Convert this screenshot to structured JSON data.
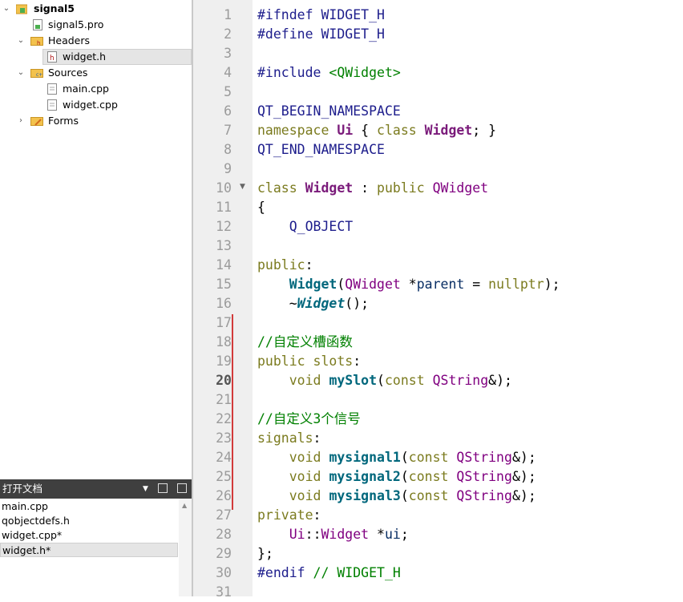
{
  "project_tree": {
    "items": [
      {
        "label": "signal5",
        "icon": "qt-project-icon",
        "level": 0,
        "expanded": true,
        "bold": true
      },
      {
        "label": "signal5.pro",
        "icon": "pro-file-icon",
        "level": 1
      },
      {
        "label": "Headers",
        "icon": "folder-headers-icon",
        "level": 1,
        "expanded": true
      },
      {
        "label": "widget.h",
        "icon": "header-file-icon",
        "level": 2,
        "selected": true
      },
      {
        "label": "Sources",
        "icon": "folder-sources-icon",
        "level": 1,
        "expanded": true
      },
      {
        "label": "main.cpp",
        "icon": "cpp-file-icon",
        "level": 2
      },
      {
        "label": "widget.cpp",
        "icon": "cpp-file-icon",
        "level": 2
      },
      {
        "label": "Forms",
        "icon": "folder-forms-icon",
        "level": 1,
        "expanded": false
      }
    ]
  },
  "open_documents": {
    "title": "打开文档",
    "items": [
      {
        "label": "main.cpp"
      },
      {
        "label": "qobjectdefs.h"
      },
      {
        "label": "widget.cpp*"
      },
      {
        "label": "widget.h*",
        "selected": true
      }
    ]
  },
  "editor": {
    "current_line": 20,
    "line_numbers": [
      "1",
      "2",
      "3",
      "4",
      "5",
      "6",
      "7",
      "8",
      "9",
      "10",
      "11",
      "12",
      "13",
      "14",
      "15",
      "16",
      "17",
      "18",
      "19",
      "20",
      "21",
      "22",
      "23",
      "24",
      "25",
      "26",
      "27",
      "28",
      "29",
      "30",
      "31"
    ],
    "lines": [
      "#ifndef WIDGET_H",
      "#define WIDGET_H",
      "",
      "#include <QWidget>",
      "",
      "QT_BEGIN_NAMESPACE",
      "namespace Ui { class Widget; }",
      "QT_END_NAMESPACE",
      "",
      "class Widget : public QWidget",
      "{",
      "    Q_OBJECT",
      "",
      "public:",
      "    Widget(QWidget *parent = nullptr);",
      "    ~Widget();",
      "",
      "//自定义槽函数",
      "public slots:",
      "    void mySlot(const QString&);",
      "",
      "//自定义3个信号",
      "signals:",
      "    void mysignal1(const QString&);",
      "    void mysignal2(const QString&);",
      "    void mysignal3(const QString&);",
      "private:",
      "    Ui::Widget *ui;",
      "};",
      "#endif // WIDGET_H",
      ""
    ]
  },
  "colors": {
    "keyword": "#7b7b1f",
    "type": "#7a1a7a",
    "function": "#00677c",
    "comment": "#008000",
    "preprocessor": "#1d1d8c",
    "modified_marker": "#d23a3a",
    "gutter_bg": "#efefef"
  }
}
